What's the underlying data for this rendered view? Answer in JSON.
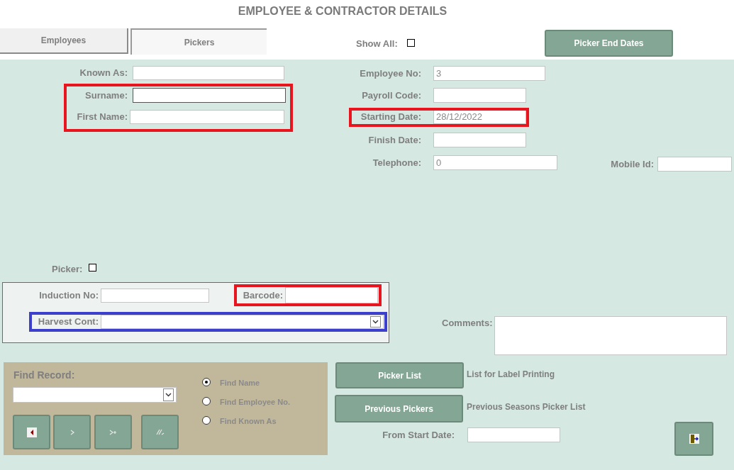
{
  "title": "EMPLOYEE & CONTRACTOR DETAILS",
  "tabs": [
    {
      "label": "Employees",
      "selected": false
    },
    {
      "label": "Pickers",
      "selected": true
    }
  ],
  "show_all": {
    "label": "Show All:",
    "checked": false
  },
  "picker_end_dates_button": "Picker End Dates",
  "fields": [
    {
      "label": "Known As:",
      "focused": false
    },
    {
      "label": "Surname:",
      "focused": true
    },
    {
      "label": "First Name:",
      "focused": false
    },
    {
      "label": "Employee No:",
      "value": "3",
      "focused": false
    },
    {
      "label": "Payroll Code:",
      "focused": false
    },
    {
      "label": "Starting Date:",
      "value": "28/12/2022",
      "focused": false
    },
    {
      "label": "Finish Date:",
      "focused": false
    },
    {
      "label": "Telephone:",
      "value": "0",
      "focused": false
    },
    {
      "label": "Mobile Id:",
      "focused": false
    }
  ],
  "picker": {
    "label": "Picker:",
    "checked": false
  },
  "induction_no": {
    "label": "Induction No:"
  },
  "barcode": {
    "label": "Barcode:"
  },
  "harvest_cont": {
    "label": "Harvest Cont:"
  },
  "comments": {
    "label": "Comments:"
  },
  "highlights": [
    {
      "color": "#e8141e"
    },
    {
      "color": "#e8141e"
    },
    {
      "color": "#e8141e"
    },
    {
      "color": "#3c3fcc"
    }
  ],
  "find_record": {
    "label": "Find Record:",
    "options": [
      {
        "label": "Find Name",
        "selected": true
      },
      {
        "label": "Find Employee No.",
        "selected": false
      },
      {
        "label": "Find Known As",
        "selected": false
      }
    ]
  },
  "actions": [
    {
      "button": "Picker List",
      "note": "List for Label Printing"
    },
    {
      "button": "Previous Pickers",
      "note": "Previous Seasons Picker List"
    }
  ],
  "from_start_date": {
    "label": "From Start Date:"
  }
}
